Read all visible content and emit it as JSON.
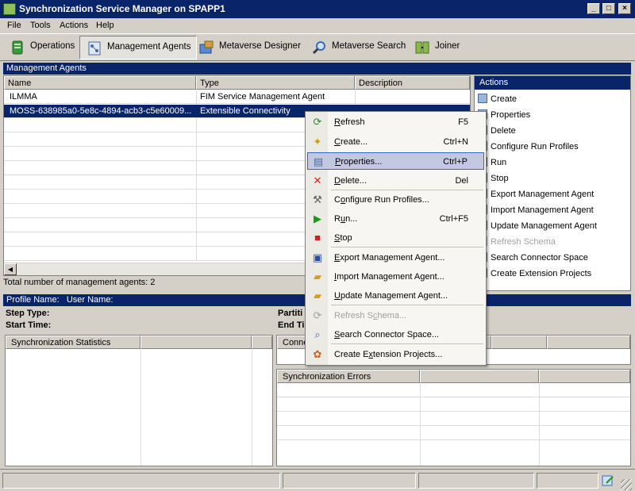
{
  "window": {
    "title": "Synchronization Service Manager on SPAPP1",
    "buttons": {
      "minimize": "_",
      "maximize": "□",
      "close": "×"
    }
  },
  "menu": [
    "File",
    "Tools",
    "Actions",
    "Help"
  ],
  "toolbar": {
    "buttons": [
      {
        "label": "Operations",
        "icon": "operations-icon"
      },
      {
        "label": "Management Agents",
        "icon": "management-agents-icon",
        "active": true
      },
      {
        "label": "Metaverse Designer",
        "icon": "metaverse-designer-icon"
      },
      {
        "label": "Metaverse Search",
        "icon": "metaverse-search-icon"
      },
      {
        "label": "Joiner",
        "icon": "joiner-icon"
      }
    ]
  },
  "management_agents": {
    "header": "Management Agents",
    "columns": [
      "Name",
      "Type",
      "Description"
    ],
    "rows": [
      {
        "name": "ILMMA",
        "type": "FIM Service Management Agent",
        "description": ""
      },
      {
        "name": "MOSS-638985a0-5e8c-4894-acb3-c5e60009...",
        "type": "Extensible Connectivity",
        "description": "",
        "selected": true
      }
    ],
    "total": "Total number of management agents: 2"
  },
  "actions": {
    "header": "Actions",
    "items": [
      {
        "label": "Create",
        "enabled": true
      },
      {
        "label": "Properties",
        "enabled": true
      },
      {
        "label": "Delete",
        "enabled": true
      },
      {
        "label": "Configure Run Profiles",
        "enabled": true
      },
      {
        "label": "Run",
        "enabled": true
      },
      {
        "label": "Stop",
        "enabled": true
      },
      {
        "label": "Export Management Agent",
        "enabled": true
      },
      {
        "label": "Import Management Agent",
        "enabled": true
      },
      {
        "label": "Update Management Agent",
        "enabled": true
      },
      {
        "label": "Refresh Schema",
        "enabled": false
      },
      {
        "label": "Search Connector Space",
        "enabled": true
      },
      {
        "label": "Create Extension Projects",
        "enabled": true
      }
    ]
  },
  "profile": {
    "profile_name_label": "Profile Name:",
    "user_name_label": "User Name:",
    "step_type_label": "Step Type:",
    "start_time_label": "Start Time:",
    "partition_label": "Partiti",
    "end_time_label": "End Ti"
  },
  "panels": {
    "sync_stats": "Synchronization Statistics",
    "connections": "Conne",
    "sync_errors": "Synchronization Errors"
  },
  "context_menu": {
    "items": [
      {
        "pre": "",
        "ul": "R",
        "post": "efresh",
        "shortcut": "F5",
        "icon": "refresh-icon",
        "glyph": "⟳",
        "color": "#2e8b2e"
      },
      {
        "pre": "",
        "ul": "C",
        "post": "reate...",
        "shortcut": "Ctrl+N",
        "icon": "create-icon",
        "glyph": "✦",
        "color": "#c9a000"
      },
      {
        "pre": "",
        "ul": "P",
        "post": "roperties...",
        "shortcut": "Ctrl+P",
        "icon": "properties-icon",
        "glyph": "▤",
        "color": "#4a6aa0",
        "highlight": true
      },
      {
        "pre": "",
        "ul": "D",
        "post": "elete...",
        "shortcut": "Del",
        "icon": "delete-icon",
        "glyph": "✕",
        "color": "#d02020"
      },
      {
        "pre": "C",
        "ul": "o",
        "post": "nfigure Run Profiles...",
        "shortcut": "",
        "icon": "configure-run-profiles-icon",
        "glyph": "⚒",
        "color": "#606060"
      },
      {
        "pre": "R",
        "ul": "u",
        "post": "n...",
        "shortcut": "Ctrl+F5",
        "icon": "run-icon",
        "glyph": "▶",
        "color": "#1a9a1a"
      },
      {
        "pre": "",
        "ul": "S",
        "post": "top",
        "shortcut": "",
        "icon": "stop-icon",
        "glyph": "■",
        "color": "#d02020"
      },
      {
        "pre": "",
        "ul": "E",
        "post": "xport Management Agent...",
        "shortcut": "",
        "icon": "export-icon",
        "glyph": "▣",
        "color": "#2a4aa0"
      },
      {
        "pre": "",
        "ul": "I",
        "post": "mport Management Agent...",
        "shortcut": "",
        "icon": "import-icon",
        "glyph": "▰",
        "color": "#d4a020"
      },
      {
        "pre": "",
        "ul": "U",
        "post": "pdate Management Agent...",
        "shortcut": "",
        "icon": "update-icon",
        "glyph": "▰",
        "color": "#d4a020"
      },
      {
        "pre": "Refresh S",
        "ul": "c",
        "post": "hema...",
        "shortcut": "",
        "icon": "refresh-schema-icon",
        "glyph": "⟳",
        "color": "#a0a0a0",
        "disabled": true
      },
      {
        "pre": "",
        "ul": "S",
        "post": "earch Connector Space...",
        "shortcut": "",
        "icon": "search-icon",
        "glyph": "⌕",
        "color": "#3a6ab0"
      },
      {
        "pre": "Create E",
        "ul": "x",
        "post": "tension Projects...",
        "shortcut": "",
        "icon": "extension-projects-icon",
        "glyph": "✿",
        "color": "#d06020"
      }
    ]
  }
}
